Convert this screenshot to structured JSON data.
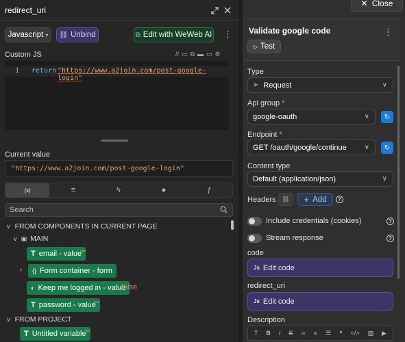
{
  "left_panel": {
    "title": "redirect_uri",
    "language_select": "Javascript",
    "unbind_label": "Unbind",
    "weweb_ai_label": "Edit with WeWeb AI",
    "custom_js_label": "Custom JS",
    "code": {
      "line_number": "1",
      "keyword": "return",
      "string": "\"https://www.a2join.com/post-google-login\""
    },
    "current_value_label": "Current value",
    "current_value": "\"https://www.a2join.com/post-google-login\"",
    "tabs": [
      "(x)",
      "db",
      "bolt",
      "user",
      "fn"
    ],
    "search_placeholder": "Search",
    "tree": {
      "section1": "FROM COMPONENTS IN CURRENT PAGE",
      "main_label": "MAIN",
      "items": [
        {
          "label": "email - value",
          "value": "\"\""
        },
        {
          "label": "Form container - form",
          "value": ""
        },
        {
          "label": "Keep me logged in - value",
          "value": "false"
        },
        {
          "label": "password - value",
          "value": "\"\""
        }
      ],
      "section2": "FROM PROJECT",
      "project_items": [
        {
          "label": "Untitled variable",
          "value": "\"\""
        }
      ]
    }
  },
  "right_panel": {
    "close_label": "Close",
    "title": "Validate google code",
    "test_label": "Test",
    "type_label": "Type",
    "type_value": "Request",
    "api_group_label": "Api group",
    "api_group_value": "google-oauth",
    "endpoint_label": "Endpoint",
    "endpoint_value": "GET /oauth/google/continue",
    "content_type_label": "Content type",
    "content_type_value": "Default (application/json)",
    "headers_label": "Headers",
    "add_label": "Add",
    "include_credentials_label": "Include credentials (cookies)",
    "stream_response_label": "Stream response",
    "code_label": "code",
    "code_btn": "Edit code",
    "redirect_label": "redirect_uri",
    "redirect_btn": "Edit code",
    "description_label": "Description",
    "required_mark": "*"
  },
  "colors": {
    "green": "#1b7a4a",
    "purple": "#3d3566",
    "blue": "#1f7ad8",
    "string_orange": "#e6a36b",
    "keyword_blue": "#6fb3f2"
  }
}
